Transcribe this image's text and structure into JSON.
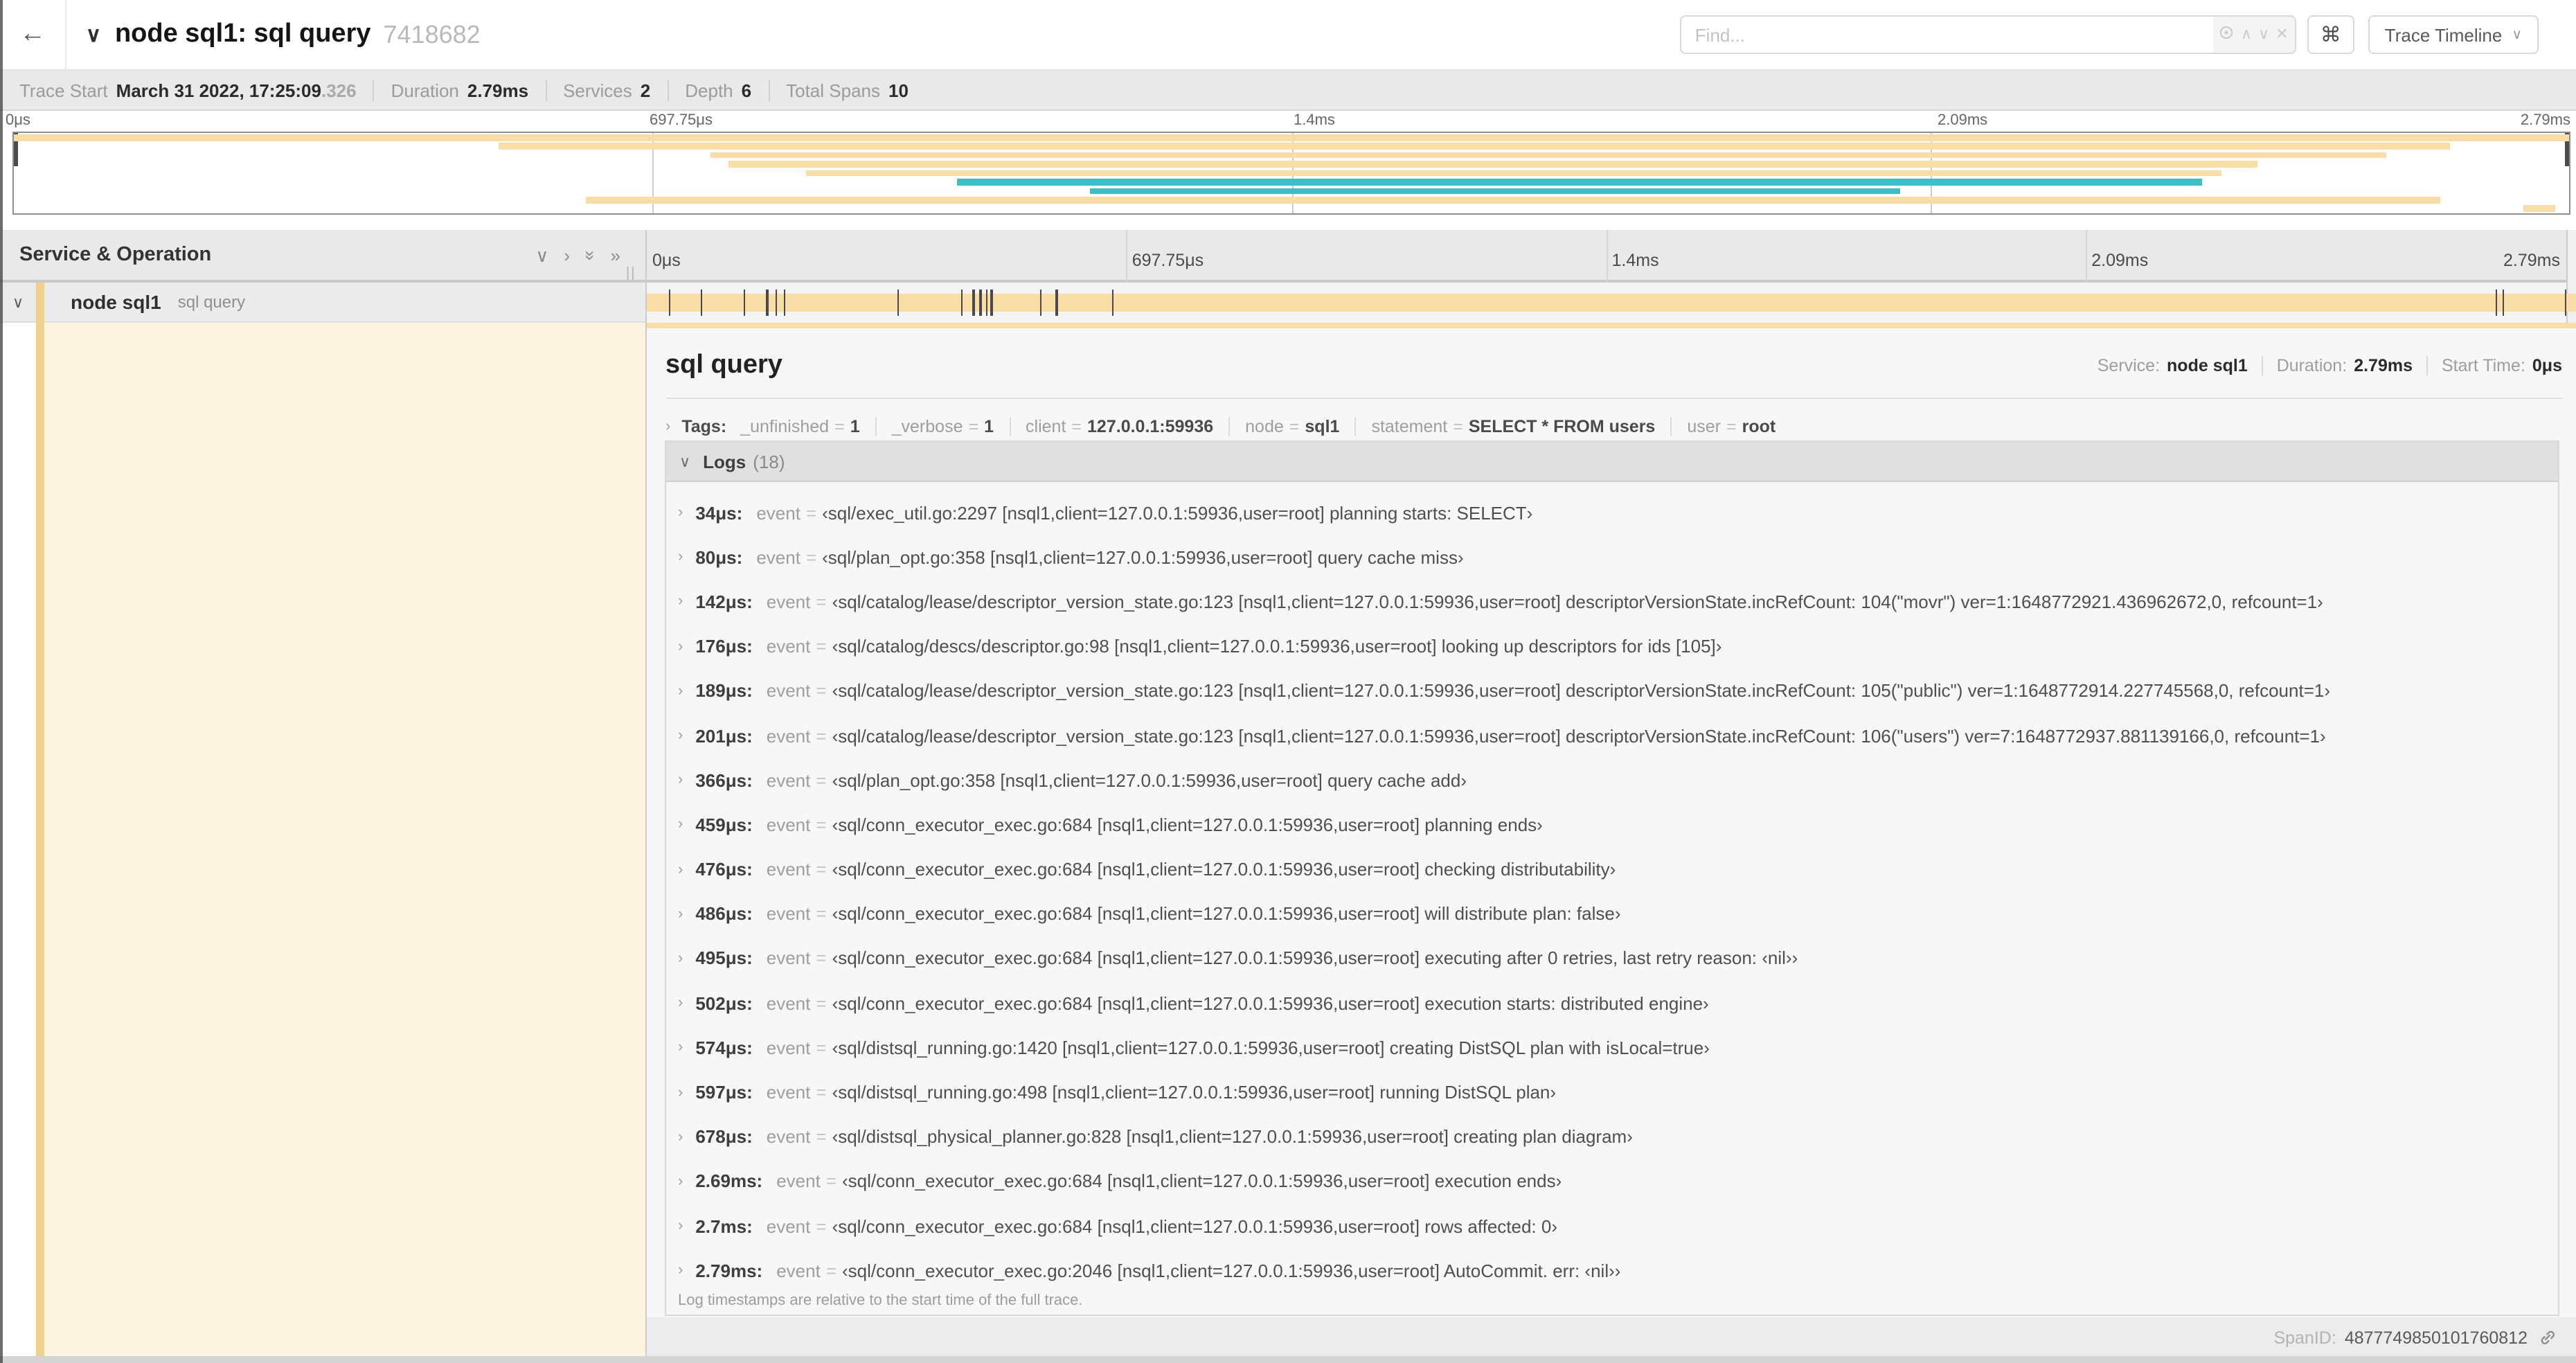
{
  "header": {
    "back_icon": "←",
    "collapse_icon": "∨",
    "title": "node sql1: sql query",
    "trace_id": "7418682",
    "find_placeholder": "Find...",
    "find_icons": {
      "prev": "∧",
      "next": "∨",
      "clear": "✕"
    },
    "shortcut_icon": "⌘",
    "view_dropdown": "Trace Timeline",
    "dropdown_chevron": "∨"
  },
  "summary": {
    "items": [
      {
        "label": "Trace Start",
        "value": "March 31 2022, 17:25:09",
        "suffix": ".326"
      },
      {
        "label": "Duration",
        "value": "2.79ms",
        "suffix": ""
      },
      {
        "label": "Services",
        "value": "2",
        "suffix": ""
      },
      {
        "label": "Depth",
        "value": "6",
        "suffix": ""
      },
      {
        "label": "Total Spans",
        "value": "10",
        "suffix": ""
      }
    ]
  },
  "timeline": {
    "ticks": [
      "0μs",
      "697.75μs",
      "1.4ms",
      "2.09ms",
      "2.79ms"
    ],
    "duration_us": 2790,
    "minimap_spans": [
      {
        "s": 0,
        "e": 2790,
        "c": "tan"
      },
      {
        "s": 530,
        "e": 2660,
        "c": "tan"
      },
      {
        "s": 760,
        "e": 2590,
        "c": "tan"
      },
      {
        "s": 780,
        "e": 2450,
        "c": "tan"
      },
      {
        "s": 865,
        "e": 2410,
        "c": "tan"
      },
      {
        "s": 1030,
        "e": 2390,
        "c": "teal"
      },
      {
        "s": 1175,
        "e": 2060,
        "c": "teal"
      },
      {
        "s": 624,
        "e": 2650,
        "c": "tan"
      },
      {
        "s": 2740,
        "e": 2775,
        "c": "tan"
      }
    ],
    "log_marks_us": [
      34,
      80,
      142,
      176,
      189,
      201,
      366,
      459,
      476,
      486,
      495,
      502,
      574,
      597,
      678,
      2690,
      2700,
      2790
    ]
  },
  "columns": {
    "left_header": "Service & Operation",
    "icons": {
      "collapse_one": "∨",
      "expand_one": "›",
      "collapse_all": "»",
      "expand_all": "»"
    },
    "drag_handle": "||"
  },
  "row": {
    "chevron": "∨",
    "service": "node sql1",
    "operation": "sql query"
  },
  "detail": {
    "title": "sql query",
    "meta": [
      {
        "label": "Service:",
        "value": "node sql1"
      },
      {
        "label": "Duration:",
        "value": "2.79ms"
      },
      {
        "label": "Start Time:",
        "value": "0μs"
      }
    ],
    "tags_chevron": "›",
    "tags_label": "Tags:",
    "tags": [
      {
        "key": "_unfinished",
        "value": "1"
      },
      {
        "key": "_verbose",
        "value": "1"
      },
      {
        "key": "client",
        "value": "127.0.0.1:59936"
      },
      {
        "key": "node",
        "value": "sql1"
      },
      {
        "key": "statement",
        "value": "SELECT * FROM users"
      },
      {
        "key": "user",
        "value": "root"
      }
    ],
    "logs_chevron": "∨",
    "logs_label": "Logs",
    "logs_count": "(18)",
    "log_key": "event",
    "logs": [
      {
        "time": "34μs:",
        "value": "‹sql/exec_util.go:2297 [nsql1,client=127.0.0.1:59936,user=root] planning starts: SELECT›"
      },
      {
        "time": "80μs:",
        "value": "‹sql/plan_opt.go:358 [nsql1,client=127.0.0.1:59936,user=root] query cache miss›"
      },
      {
        "time": "142μs:",
        "value": "‹sql/catalog/lease/descriptor_version_state.go:123 [nsql1,client=127.0.0.1:59936,user=root] descriptorVersionState.incRefCount: 104(\"movr\") ver=1:1648772921.436962672,0, refcount=1›"
      },
      {
        "time": "176μs:",
        "value": "‹sql/catalog/descs/descriptor.go:98 [nsql1,client=127.0.0.1:59936,user=root] looking up descriptors for ids [105]›"
      },
      {
        "time": "189μs:",
        "value": "‹sql/catalog/lease/descriptor_version_state.go:123 [nsql1,client=127.0.0.1:59936,user=root] descriptorVersionState.incRefCount: 105(\"public\") ver=1:1648772914.227745568,0, refcount=1›"
      },
      {
        "time": "201μs:",
        "value": "‹sql/catalog/lease/descriptor_version_state.go:123 [nsql1,client=127.0.0.1:59936,user=root] descriptorVersionState.incRefCount: 106(\"users\") ver=7:1648772937.881139166,0, refcount=1›"
      },
      {
        "time": "366μs:",
        "value": "‹sql/plan_opt.go:358 [nsql1,client=127.0.0.1:59936,user=root] query cache add›"
      },
      {
        "time": "459μs:",
        "value": "‹sql/conn_executor_exec.go:684 [nsql1,client=127.0.0.1:59936,user=root] planning ends›"
      },
      {
        "time": "476μs:",
        "value": "‹sql/conn_executor_exec.go:684 [nsql1,client=127.0.0.1:59936,user=root] checking distributability›"
      },
      {
        "time": "486μs:",
        "value": "‹sql/conn_executor_exec.go:684 [nsql1,client=127.0.0.1:59936,user=root] will distribute plan: false›"
      },
      {
        "time": "495μs:",
        "value": "‹sql/conn_executor_exec.go:684 [nsql1,client=127.0.0.1:59936,user=root] executing after 0 retries, last retry reason: ‹nil››"
      },
      {
        "time": "502μs:",
        "value": "‹sql/conn_executor_exec.go:684 [nsql1,client=127.0.0.1:59936,user=root] execution starts: distributed engine›"
      },
      {
        "time": "574μs:",
        "value": "‹sql/distsql_running.go:1420 [nsql1,client=127.0.0.1:59936,user=root] creating DistSQL plan with isLocal=true›"
      },
      {
        "time": "597μs:",
        "value": "‹sql/distsql_running.go:498 [nsql1,client=127.0.0.1:59936,user=root] running DistSQL plan›"
      },
      {
        "time": "678μs:",
        "value": "‹sql/distsql_physical_planner.go:828 [nsql1,client=127.0.0.1:59936,user=root] creating plan diagram›"
      },
      {
        "time": "2.69ms:",
        "value": "‹sql/conn_executor_exec.go:684 [nsql1,client=127.0.0.1:59936,user=root] execution ends›"
      },
      {
        "time": "2.7ms:",
        "value": "‹sql/conn_executor_exec.go:684 [nsql1,client=127.0.0.1:59936,user=root] rows affected: 0›"
      },
      {
        "time": "2.79ms:",
        "value": "‹sql/conn_executor_exec.go:2046 [nsql1,client=127.0.0.1:59936,user=root] AutoCommit. err: ‹nil››"
      }
    ],
    "logs_note": "Log timestamps are relative to the start time of the full trace.",
    "span_id_label": "SpanID:",
    "span_id": "4877749850101760812"
  },
  "colors": {
    "tan": "#f8dda6",
    "teal": "#3cbfc6",
    "accent": "#f0d18c",
    "cream": "#fcf4e1"
  }
}
